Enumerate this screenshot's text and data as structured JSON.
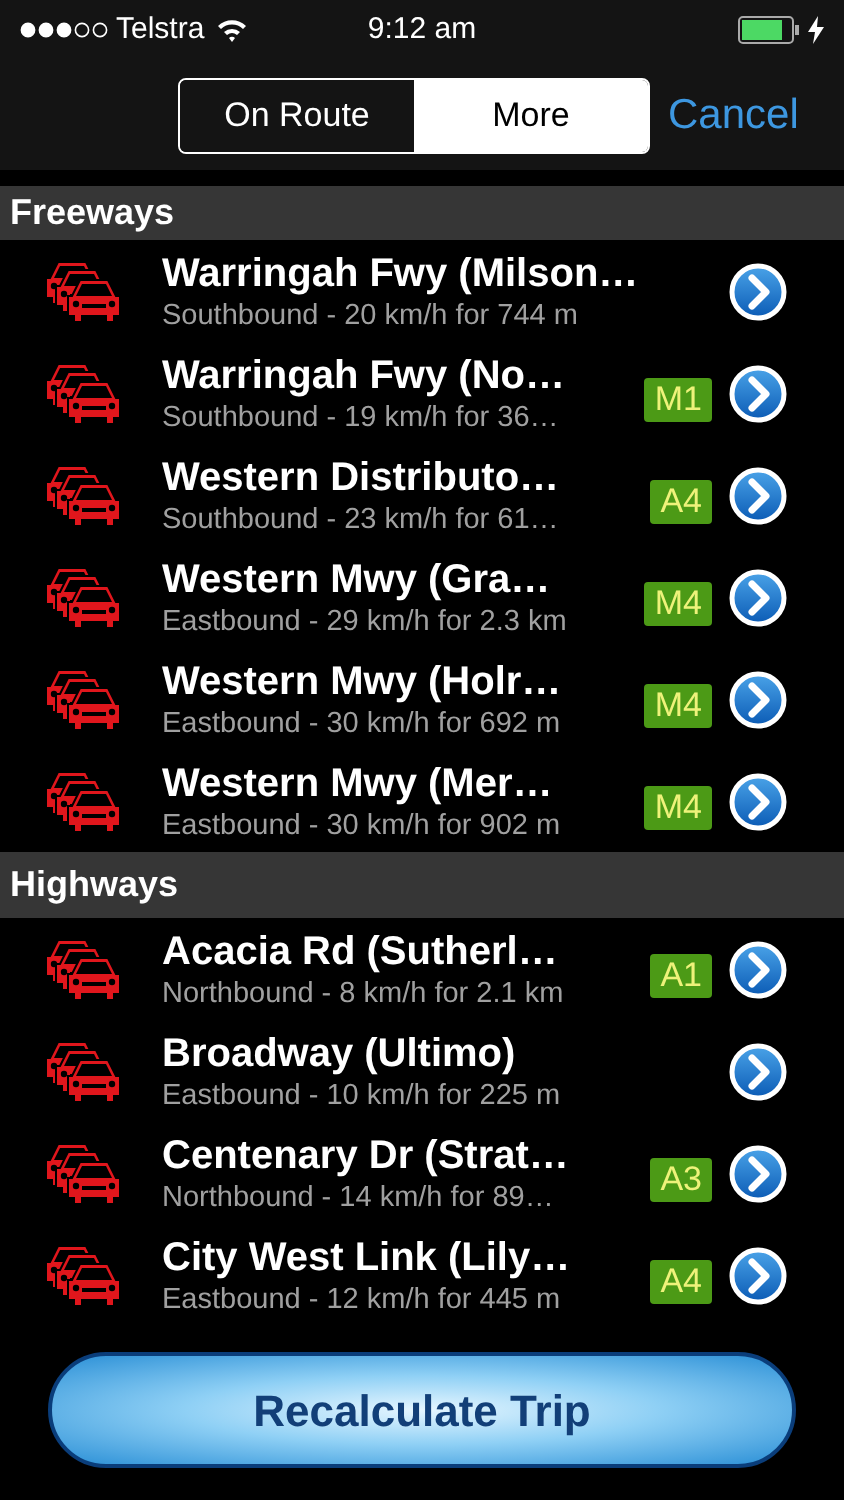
{
  "status_bar": {
    "carrier": "Telstra",
    "time": "9:12 am"
  },
  "tabs": [
    {
      "label": "On Route",
      "selected": false
    },
    {
      "label": "More",
      "selected": true
    }
  ],
  "cancel": "Cancel",
  "sections": [
    {
      "title": "Freeways",
      "rows": [
        {
          "title": "Warringah Fwy (Milson…",
          "subtitle": "Southbound - 20 km/h for 744 m"
        },
        {
          "title": "Warringah Fwy (No…",
          "subtitle": "Southbound - 19 km/h for 36…",
          "badge": "M1"
        },
        {
          "title": "Western Distributo…",
          "subtitle": "Southbound - 23 km/h for 61…",
          "badge": "A4"
        },
        {
          "title": "Western Mwy (Gra…",
          "subtitle": "Eastbound - 29 km/h for 2.3 km",
          "badge": "M4"
        },
        {
          "title": "Western Mwy (Holr…",
          "subtitle": "Eastbound - 30 km/h for 692 m",
          "badge": "M4"
        },
        {
          "title": "Western Mwy (Mer…",
          "subtitle": "Eastbound - 30 km/h for 902 m",
          "badge": "M4"
        }
      ]
    },
    {
      "title": "Highways",
      "rows": [
        {
          "title": "Acacia Rd (Sutherl…",
          "subtitle": "Northbound - 8 km/h for 2.1 km",
          "badge": "A1"
        },
        {
          "title": "Broadway (Ultimo)",
          "subtitle": "Eastbound - 10 km/h for 225 m"
        },
        {
          "title": "Centenary Dr (Strat…",
          "subtitle": "Northbound - 14 km/h for 89…",
          "badge": "A3"
        },
        {
          "title": "City West Link (Lily…",
          "subtitle": "Eastbound - 12 km/h for 445 m",
          "badge": "A4"
        }
      ]
    }
  ],
  "action_button": "Recalculate Trip"
}
